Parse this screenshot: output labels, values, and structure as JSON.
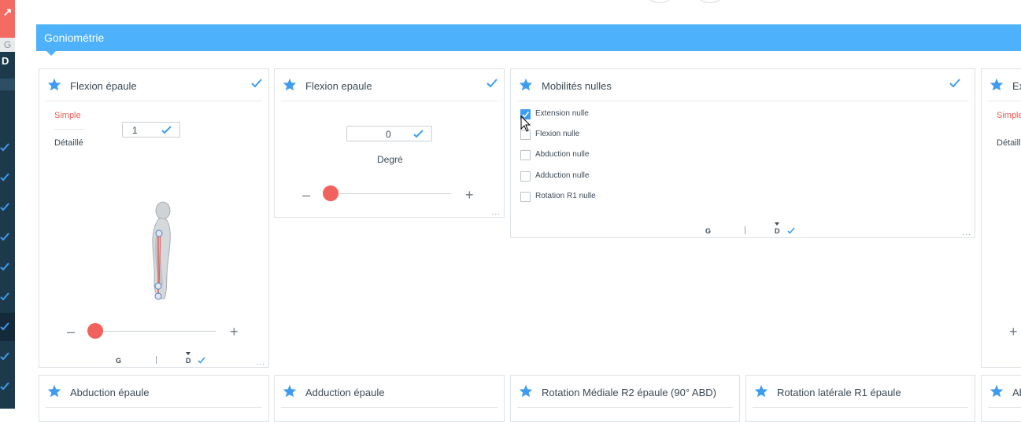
{
  "sidebar": {
    "top_label": "↗",
    "side_g": "G",
    "side_d": "D"
  },
  "section": {
    "title": "Goniométrie"
  },
  "colors": {
    "accent": "#4db1fb",
    "primary_red": "#f0625b",
    "check_blue": "#3d9cf0",
    "sidebar": "#1d3a4d"
  },
  "cards": {
    "flexion1": {
      "title": "Flexion épaule",
      "mode_simple": "Simple",
      "mode_detail": "Détaillé",
      "value": "1",
      "minus": "–",
      "plus": "+",
      "side_g": "G",
      "side_sep": "|",
      "side_d": "D",
      "more": "..."
    },
    "flexion2": {
      "title": "Flexion epaule",
      "value": "0",
      "unit_label": "Degré",
      "minus": "–",
      "plus": "+",
      "more": "..."
    },
    "mobilites": {
      "title": "Mobilités nulles",
      "options": [
        {
          "label": "Extension nulle",
          "checked": true
        },
        {
          "label": "Flexion nulle",
          "checked": false
        },
        {
          "label": "Abduction nulle",
          "checked": false
        },
        {
          "label": "Adduction nulle",
          "checked": false
        },
        {
          "label": "Rotation R1 nulle",
          "checked": false
        }
      ],
      "side_g": "G",
      "side_sep": "|",
      "side_d": "D",
      "more": "..."
    },
    "extension_partial": {
      "title": "Ex",
      "mode_simple": "Simple",
      "mode_detail": "Détaill",
      "plus": "+"
    }
  },
  "bottom_cards": [
    {
      "title": "Abduction épaule"
    },
    {
      "title": "Adduction épaule"
    },
    {
      "title": "Rotation Médiale R2 épaule (90° ABD)"
    },
    {
      "title": "Rotation latérale R1 épaule"
    },
    {
      "title": "Ab"
    }
  ]
}
